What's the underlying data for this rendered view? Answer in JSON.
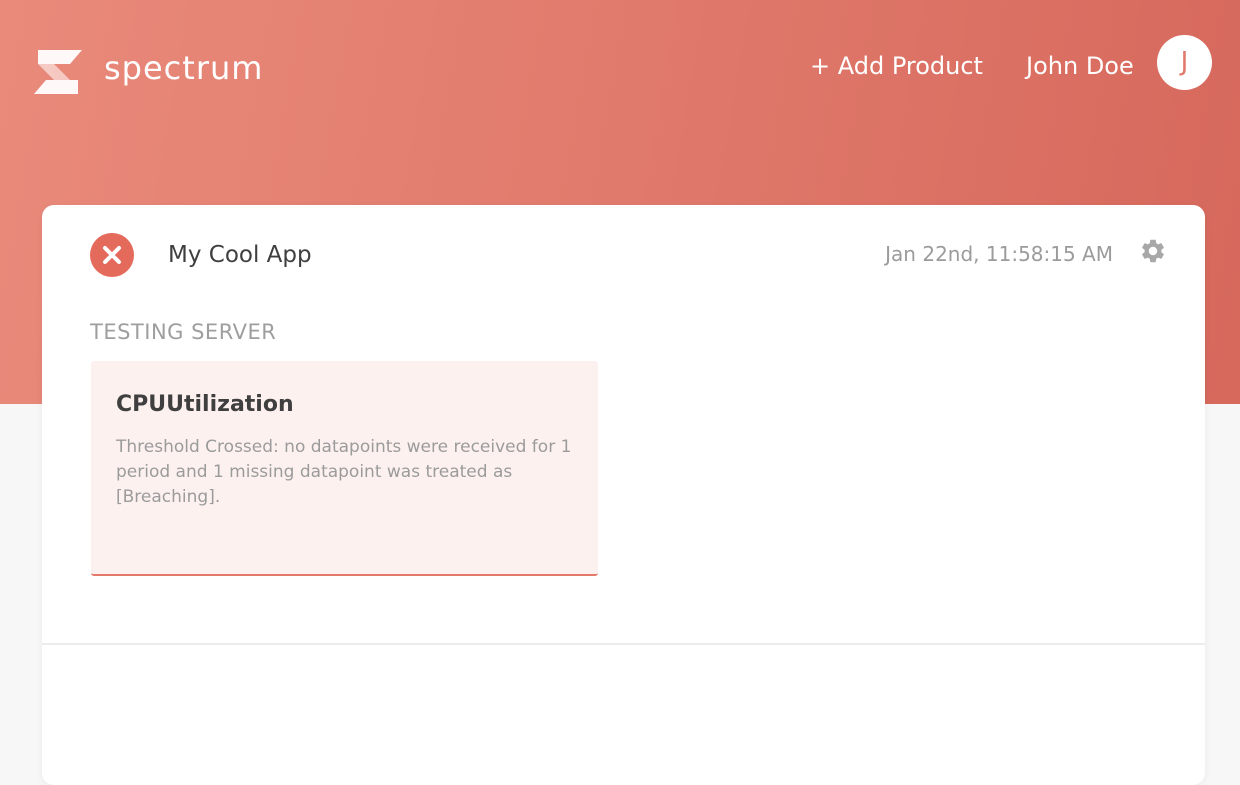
{
  "header": {
    "brand": "spectrum",
    "add_product_label": "+ Add Product",
    "user_name": "John Doe",
    "avatar_initial": "J"
  },
  "app_card": {
    "app_name": "My Cool App",
    "status": "error",
    "timestamp": "Jan 22nd, 11:58:15 AM",
    "section_label": "TESTING SERVER",
    "alerts": [
      {
        "title": "CPUUtilization",
        "description": "Threshold Crossed: no datapoints were received for 1 period and 1 missing datapoint was treated as [Breaching]."
      }
    ]
  },
  "icons": {
    "logo": "spectrum-logo-icon",
    "status": "error-x-icon",
    "settings": "gear-icon"
  },
  "colors": {
    "accent": "#e07a6c",
    "error": "#e46a5c",
    "alert_background": "#fdf1f0"
  }
}
